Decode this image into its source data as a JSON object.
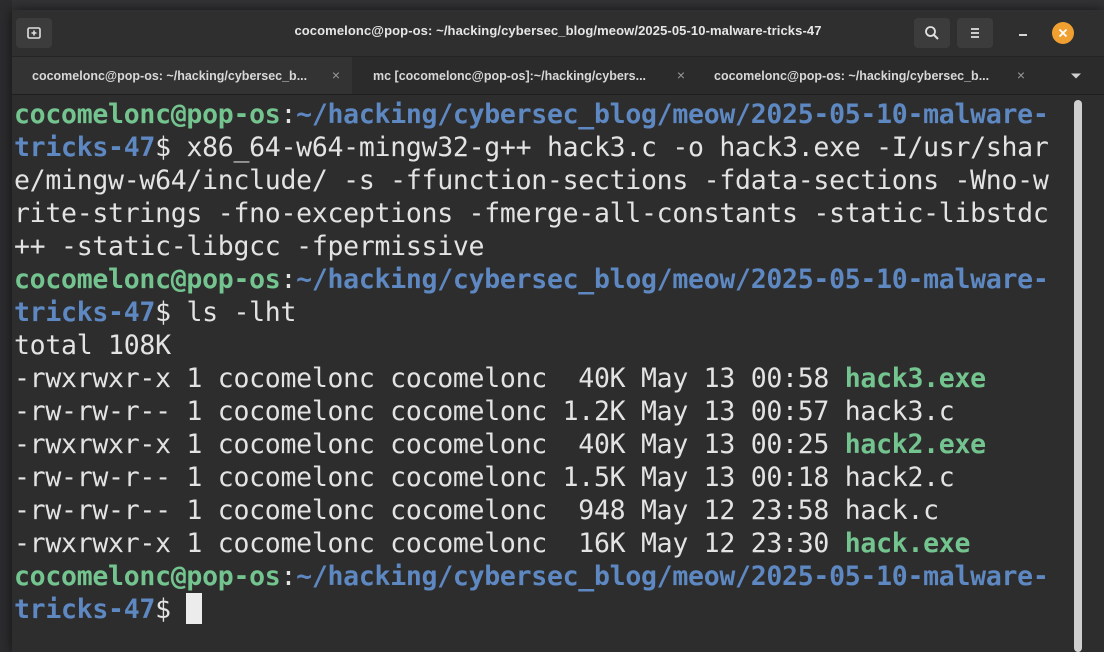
{
  "window": {
    "title": "cocomelonc@pop-os: ~/hacking/cybersec_blog/meow/2025-05-10-malware-tricks-47"
  },
  "tabs": [
    {
      "label": "cocomelonc@pop-os: ~/hacking/cybersec_b...",
      "close": "×",
      "active": true
    },
    {
      "label": "mc [cocomelonc@pop-os]:~/hacking/cybers...",
      "close": "×",
      "active": false
    },
    {
      "label": "cocomelonc@pop-os: ~/hacking/cybersec_b...",
      "close": "×",
      "active": false
    }
  ],
  "icons": {
    "new_tab": "new-tab-icon",
    "search": "search-icon",
    "menu": "hamburger-menu-icon",
    "minimize": "minimize-icon",
    "close": "close-icon",
    "tabs_dropdown": "chevron-down-icon"
  },
  "colors": {
    "user": "#73c48f",
    "path": "#5e88c2",
    "exe": "#73c48f",
    "text": "#e3e3e3",
    "close_button": "#f0a030"
  },
  "terminal": {
    "prompt_user": "cocomelonc@pop-os",
    "prompt_sep": ":",
    "prompt_path_1": "~/hacking/cybersec_blog/meow/2025-05-10-malware-",
    "prompt_path_2": "tricks-47",
    "prompt_symbol": "$ ",
    "cmd1_line1": "x86_64-w64-mingw32-g++ hack3.c -o hack3.exe -I/usr/shar",
    "cmd1_line2": "e/mingw-w64/include/ -s -ffunction-sections -fdata-sections -Wno-w",
    "cmd1_line3": "rite-strings -fno-exceptions -fmerge-all-constants -static-libstdc",
    "cmd1_line4": "++ -static-libgcc -fpermissive",
    "cmd2": "ls -lht",
    "total": "total 108K",
    "files": [
      {
        "meta": "-rwxrwxr-x 1 cocomelonc cocomelonc  40K May 13 00:58 ",
        "name": "hack3.exe",
        "exe": true
      },
      {
        "meta": "-rw-rw-r-- 1 cocomelonc cocomelonc 1.2K May 13 00:57 ",
        "name": "hack3.c",
        "exe": false
      },
      {
        "meta": "-rwxrwxr-x 1 cocomelonc cocomelonc  40K May 13 00:25 ",
        "name": "hack2.exe",
        "exe": true
      },
      {
        "meta": "-rw-rw-r-- 1 cocomelonc cocomelonc 1.5K May 13 00:18 ",
        "name": "hack2.c",
        "exe": false
      },
      {
        "meta": "-rw-rw-r-- 1 cocomelonc cocomelonc  948 May 12 23:58 ",
        "name": "hack.c",
        "exe": false
      },
      {
        "meta": "-rwxrwxr-x 1 cocomelonc cocomelonc  16K May 12 23:30 ",
        "name": "hack.exe",
        "exe": true
      }
    ]
  }
}
